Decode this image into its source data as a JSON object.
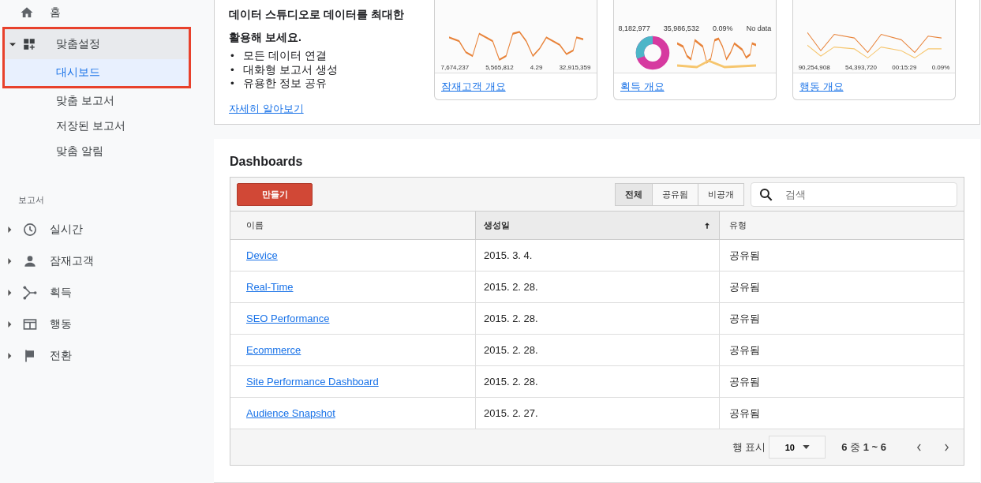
{
  "sidebar": {
    "home": {
      "label": "홈"
    },
    "customization": {
      "label": "맞춤설정",
      "expanded": true,
      "outlined": true,
      "children": [
        {
          "label": "대시보드",
          "selected": true
        },
        {
          "label": "맞춤 보고서",
          "selected": false
        },
        {
          "label": "저장된 보고서",
          "selected": false
        },
        {
          "label": "맞춤 알림",
          "selected": false
        }
      ]
    },
    "section_label": "보고서",
    "reports": [
      {
        "label": "실시간",
        "kind": "clock",
        "expanded": false
      },
      {
        "label": "잠재고객",
        "kind": "person",
        "expanded": false
      },
      {
        "label": "획득",
        "kind": "branch",
        "expanded": false
      },
      {
        "label": "행동",
        "kind": "window",
        "expanded": false
      },
      {
        "label": "전환",
        "kind": "flag",
        "expanded": false
      }
    ]
  },
  "promo": {
    "heading": "데이터 스튜디오로 데이터를 최대한 활용해 보세요.",
    "bullet_marker": "•",
    "bullets": [
      "모든 데이터 연결",
      "대화형 보고서 생성",
      "유용한 정보 공유"
    ],
    "link": "자세히 알아보기"
  },
  "templates": [
    {
      "kind": "audience",
      "metrics": [
        "7,674,237",
        "5,565,812",
        "4.29",
        "32,915,359"
      ],
      "link": "잠재고객 개요"
    },
    {
      "kind": "acquisition",
      "metrics": [
        "8,182,977",
        "35,986,532",
        "0.09%",
        "No data"
      ],
      "link": "획득 개요"
    },
    {
      "kind": "behavior",
      "metrics": [
        "90,254,908",
        "54,393,720",
        "00:15:29",
        "0.09%"
      ],
      "link": "행동 개요"
    }
  ],
  "dashboards": {
    "title": "Dashboards",
    "create_button": "만들기",
    "filters": [
      {
        "label": "전체",
        "selected": true
      },
      {
        "label": "공유됨",
        "selected": false
      },
      {
        "label": "비공개",
        "selected": false
      }
    ],
    "search": {
      "placeholder": "검색"
    },
    "columns": [
      {
        "label": "이름",
        "sorted": false
      },
      {
        "label": "생성일",
        "sorted": true
      },
      {
        "label": "유형",
        "sorted": false
      }
    ],
    "rows": [
      {
        "name": "Device",
        "created": "2015. 3. 4.",
        "type": "공유됨"
      },
      {
        "name": "Real-Time",
        "created": "2015. 2. 28.",
        "type": "공유됨"
      },
      {
        "name": "SEO Performance",
        "created": "2015. 2. 28.",
        "type": "공유됨"
      },
      {
        "name": "Ecommerce",
        "created": "2015. 2. 28.",
        "type": "공유됨"
      },
      {
        "name": "Site Performance Dashboard",
        "created": "2015. 2. 28.",
        "type": "공유됨"
      },
      {
        "name": "Audience Snapshot",
        "created": "2015. 2. 27.",
        "type": "공유됨"
      }
    ],
    "footer": {
      "rows_label": "행 표시",
      "page_size": "10",
      "range": "**6** 중 **1 ~ 6**"
    }
  }
}
